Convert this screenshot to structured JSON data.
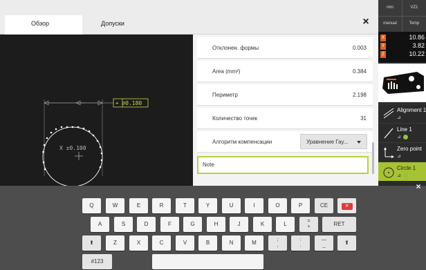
{
  "dialog": {
    "tabs": [
      "Обзор",
      "Допуски"
    ],
    "close_label": "×",
    "view": {
      "tolerance_label": "⌖ ⌀0.180",
      "center_label": "X ±0.100"
    },
    "properties": [
      {
        "label": "Отклонен. формы",
        "value": "0.003"
      },
      {
        "label": "Area (mm²)",
        "value": "0.384"
      },
      {
        "label": "Периметр",
        "value": "2.198"
      },
      {
        "label": "Количество точек",
        "value": "31"
      }
    ],
    "compensation": {
      "label": "Алгоритм компенсации",
      "value": "Уравнение Гау..."
    },
    "note": {
      "value": "Note"
    }
  },
  "right_panel": {
    "unit": "mm",
    "vz": "VZ1",
    "mode": "manual",
    "temp": "Temp",
    "coords": [
      {
        "axis": "X",
        "value": "10.86"
      },
      {
        "axis": "Y",
        "value": "3.82"
      },
      {
        "axis": "Z",
        "value": "10.22"
      }
    ],
    "features": [
      {
        "name": "Alignment 1",
        "sub": "⊿"
      },
      {
        "name": "Line 1",
        "sub": "⊿"
      },
      {
        "name": "Zero point",
        "sub": "⊿"
      },
      {
        "name": "Circle 1",
        "sub": "⊿"
      }
    ],
    "colors": {
      "accent": "#a7c232",
      "axis": "#e0621b"
    }
  },
  "keyboard": {
    "close_label": "×",
    "row1": [
      "Q",
      "W",
      "E",
      "R",
      "T",
      "Y",
      "U",
      "I",
      "O",
      "P",
      "CE"
    ],
    "row2": [
      "A",
      "S",
      "D",
      "F",
      "G",
      "H",
      "J",
      "K",
      "L"
    ],
    "row2_extra": [
      "=",
      "+"
    ],
    "enter": "RET",
    "row3": [
      "Z",
      "X",
      "C",
      "V",
      "B",
      "N",
      "M"
    ],
    "row3_punct": [
      [
        ";",
        ","
      ],
      [
        ":",
        "."
      ],
      [
        "—",
        "_"
      ]
    ],
    "symbols_key": "#123",
    "delete_icon": "backspace-icon",
    "shift_icon": "shift-icon"
  }
}
